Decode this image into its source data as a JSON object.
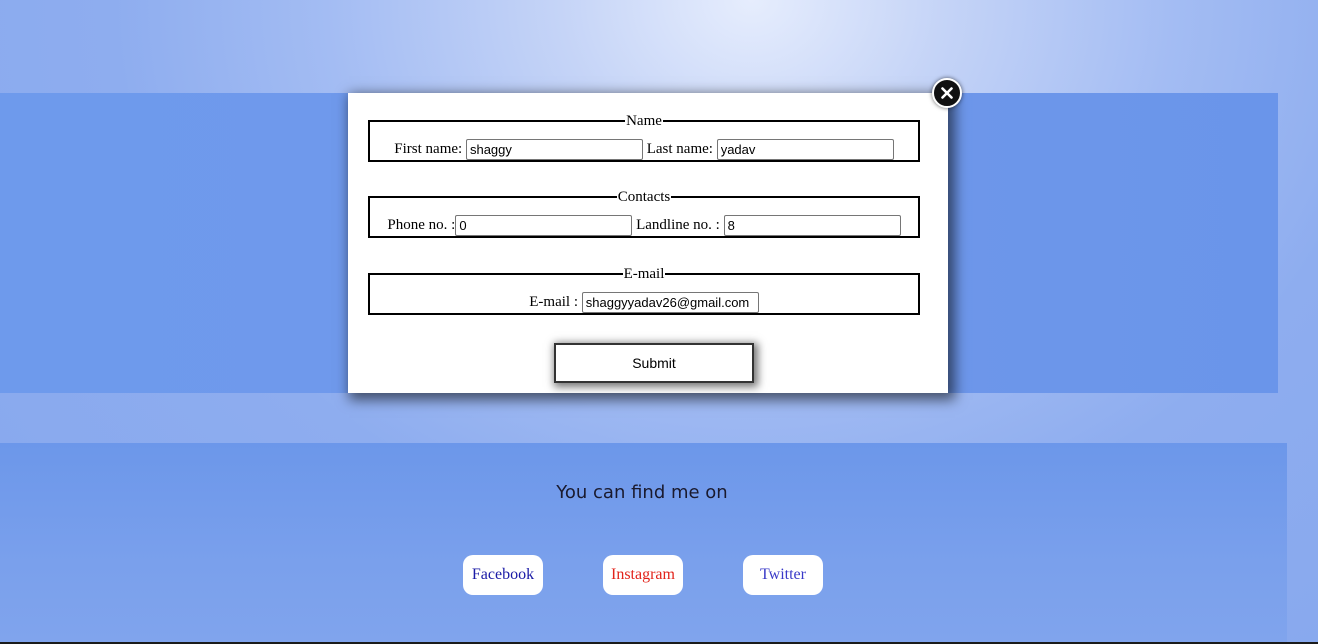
{
  "modal": {
    "name_group": {
      "legend": "Name",
      "first_label": "First name:",
      "first_value": "shaggy",
      "last_label": "Last name:",
      "last_value": "yadav"
    },
    "contacts_group": {
      "legend": "Contacts",
      "phone_label": "Phone no. :",
      "phone_value": "0",
      "landline_label": "Landline no. :",
      "landline_value": "8"
    },
    "email_group": {
      "legend": "E-mail",
      "email_label": "E-mail :",
      "email_value": "shaggyyadav26@gmail.com"
    },
    "submit_label": "Submit",
    "close_icon": "close-icon"
  },
  "footer": {
    "heading": "You can find me on",
    "links": [
      {
        "label": "Facebook",
        "color": "#1a1aa6"
      },
      {
        "label": "Instagram",
        "color": "#e2231a"
      },
      {
        "label": "Twitter",
        "color": "#3a3ac8"
      }
    ]
  }
}
